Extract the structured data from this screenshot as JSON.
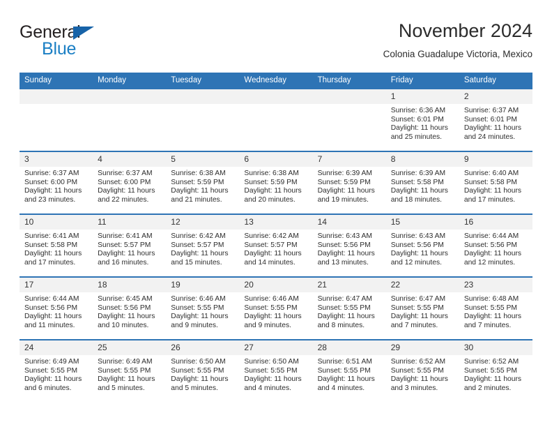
{
  "brand": {
    "name_part1": "General",
    "name_part2": "Blue",
    "triangle_icon": "triangle-icon",
    "colors": {
      "dark": "#231f20",
      "blue": "#1b7fc4",
      "triangle": "#1763a8"
    }
  },
  "header": {
    "title": "November 2024",
    "subtitle": "Colonia Guadalupe Victoria, Mexico"
  },
  "theme": {
    "header_blue": "#2e74b5",
    "daynum_band": "#f2f2f2",
    "text": "#2d2d2d"
  },
  "calendar": {
    "weekday_headers": [
      "Sunday",
      "Monday",
      "Tuesday",
      "Wednesday",
      "Thursday",
      "Friday",
      "Saturday"
    ],
    "labels": {
      "sunrise": "Sunrise:",
      "sunset": "Sunset:",
      "daylight": "Daylight:"
    },
    "weeks": [
      [
        {
          "day": "",
          "empty": true
        },
        {
          "day": "",
          "empty": true
        },
        {
          "day": "",
          "empty": true
        },
        {
          "day": "",
          "empty": true
        },
        {
          "day": "",
          "empty": true
        },
        {
          "day": "1",
          "sunrise": "Sunrise: 6:36 AM",
          "sunset": "Sunset: 6:01 PM",
          "daylight_line1": "Daylight: 11 hours",
          "daylight_line2": "and 25 minutes."
        },
        {
          "day": "2",
          "sunrise": "Sunrise: 6:37 AM",
          "sunset": "Sunset: 6:01 PM",
          "daylight_line1": "Daylight: 11 hours",
          "daylight_line2": "and 24 minutes."
        }
      ],
      [
        {
          "day": "3",
          "sunrise": "Sunrise: 6:37 AM",
          "sunset": "Sunset: 6:00 PM",
          "daylight_line1": "Daylight: 11 hours",
          "daylight_line2": "and 23 minutes."
        },
        {
          "day": "4",
          "sunrise": "Sunrise: 6:37 AM",
          "sunset": "Sunset: 6:00 PM",
          "daylight_line1": "Daylight: 11 hours",
          "daylight_line2": "and 22 minutes."
        },
        {
          "day": "5",
          "sunrise": "Sunrise: 6:38 AM",
          "sunset": "Sunset: 5:59 PM",
          "daylight_line1": "Daylight: 11 hours",
          "daylight_line2": "and 21 minutes."
        },
        {
          "day": "6",
          "sunrise": "Sunrise: 6:38 AM",
          "sunset": "Sunset: 5:59 PM",
          "daylight_line1": "Daylight: 11 hours",
          "daylight_line2": "and 20 minutes."
        },
        {
          "day": "7",
          "sunrise": "Sunrise: 6:39 AM",
          "sunset": "Sunset: 5:59 PM",
          "daylight_line1": "Daylight: 11 hours",
          "daylight_line2": "and 19 minutes."
        },
        {
          "day": "8",
          "sunrise": "Sunrise: 6:39 AM",
          "sunset": "Sunset: 5:58 PM",
          "daylight_line1": "Daylight: 11 hours",
          "daylight_line2": "and 18 minutes."
        },
        {
          "day": "9",
          "sunrise": "Sunrise: 6:40 AM",
          "sunset": "Sunset: 5:58 PM",
          "daylight_line1": "Daylight: 11 hours",
          "daylight_line2": "and 17 minutes."
        }
      ],
      [
        {
          "day": "10",
          "sunrise": "Sunrise: 6:41 AM",
          "sunset": "Sunset: 5:58 PM",
          "daylight_line1": "Daylight: 11 hours",
          "daylight_line2": "and 17 minutes."
        },
        {
          "day": "11",
          "sunrise": "Sunrise: 6:41 AM",
          "sunset": "Sunset: 5:57 PM",
          "daylight_line1": "Daylight: 11 hours",
          "daylight_line2": "and 16 minutes."
        },
        {
          "day": "12",
          "sunrise": "Sunrise: 6:42 AM",
          "sunset": "Sunset: 5:57 PM",
          "daylight_line1": "Daylight: 11 hours",
          "daylight_line2": "and 15 minutes."
        },
        {
          "day": "13",
          "sunrise": "Sunrise: 6:42 AM",
          "sunset": "Sunset: 5:57 PM",
          "daylight_line1": "Daylight: 11 hours",
          "daylight_line2": "and 14 minutes."
        },
        {
          "day": "14",
          "sunrise": "Sunrise: 6:43 AM",
          "sunset": "Sunset: 5:56 PM",
          "daylight_line1": "Daylight: 11 hours",
          "daylight_line2": "and 13 minutes."
        },
        {
          "day": "15",
          "sunrise": "Sunrise: 6:43 AM",
          "sunset": "Sunset: 5:56 PM",
          "daylight_line1": "Daylight: 11 hours",
          "daylight_line2": "and 12 minutes."
        },
        {
          "day": "16",
          "sunrise": "Sunrise: 6:44 AM",
          "sunset": "Sunset: 5:56 PM",
          "daylight_line1": "Daylight: 11 hours",
          "daylight_line2": "and 12 minutes."
        }
      ],
      [
        {
          "day": "17",
          "sunrise": "Sunrise: 6:44 AM",
          "sunset": "Sunset: 5:56 PM",
          "daylight_line1": "Daylight: 11 hours",
          "daylight_line2": "and 11 minutes."
        },
        {
          "day": "18",
          "sunrise": "Sunrise: 6:45 AM",
          "sunset": "Sunset: 5:56 PM",
          "daylight_line1": "Daylight: 11 hours",
          "daylight_line2": "and 10 minutes."
        },
        {
          "day": "19",
          "sunrise": "Sunrise: 6:46 AM",
          "sunset": "Sunset: 5:55 PM",
          "daylight_line1": "Daylight: 11 hours",
          "daylight_line2": "and 9 minutes."
        },
        {
          "day": "20",
          "sunrise": "Sunrise: 6:46 AM",
          "sunset": "Sunset: 5:55 PM",
          "daylight_line1": "Daylight: 11 hours",
          "daylight_line2": "and 9 minutes."
        },
        {
          "day": "21",
          "sunrise": "Sunrise: 6:47 AM",
          "sunset": "Sunset: 5:55 PM",
          "daylight_line1": "Daylight: 11 hours",
          "daylight_line2": "and 8 minutes."
        },
        {
          "day": "22",
          "sunrise": "Sunrise: 6:47 AM",
          "sunset": "Sunset: 5:55 PM",
          "daylight_line1": "Daylight: 11 hours",
          "daylight_line2": "and 7 minutes."
        },
        {
          "day": "23",
          "sunrise": "Sunrise: 6:48 AM",
          "sunset": "Sunset: 5:55 PM",
          "daylight_line1": "Daylight: 11 hours",
          "daylight_line2": "and 7 minutes."
        }
      ],
      [
        {
          "day": "24",
          "sunrise": "Sunrise: 6:49 AM",
          "sunset": "Sunset: 5:55 PM",
          "daylight_line1": "Daylight: 11 hours",
          "daylight_line2": "and 6 minutes."
        },
        {
          "day": "25",
          "sunrise": "Sunrise: 6:49 AM",
          "sunset": "Sunset: 5:55 PM",
          "daylight_line1": "Daylight: 11 hours",
          "daylight_line2": "and 5 minutes."
        },
        {
          "day": "26",
          "sunrise": "Sunrise: 6:50 AM",
          "sunset": "Sunset: 5:55 PM",
          "daylight_line1": "Daylight: 11 hours",
          "daylight_line2": "and 5 minutes."
        },
        {
          "day": "27",
          "sunrise": "Sunrise: 6:50 AM",
          "sunset": "Sunset: 5:55 PM",
          "daylight_line1": "Daylight: 11 hours",
          "daylight_line2": "and 4 minutes."
        },
        {
          "day": "28",
          "sunrise": "Sunrise: 6:51 AM",
          "sunset": "Sunset: 5:55 PM",
          "daylight_line1": "Daylight: 11 hours",
          "daylight_line2": "and 4 minutes."
        },
        {
          "day": "29",
          "sunrise": "Sunrise: 6:52 AM",
          "sunset": "Sunset: 5:55 PM",
          "daylight_line1": "Daylight: 11 hours",
          "daylight_line2": "and 3 minutes."
        },
        {
          "day": "30",
          "sunrise": "Sunrise: 6:52 AM",
          "sunset": "Sunset: 5:55 PM",
          "daylight_line1": "Daylight: 11 hours",
          "daylight_line2": "and 2 minutes."
        }
      ]
    ]
  }
}
